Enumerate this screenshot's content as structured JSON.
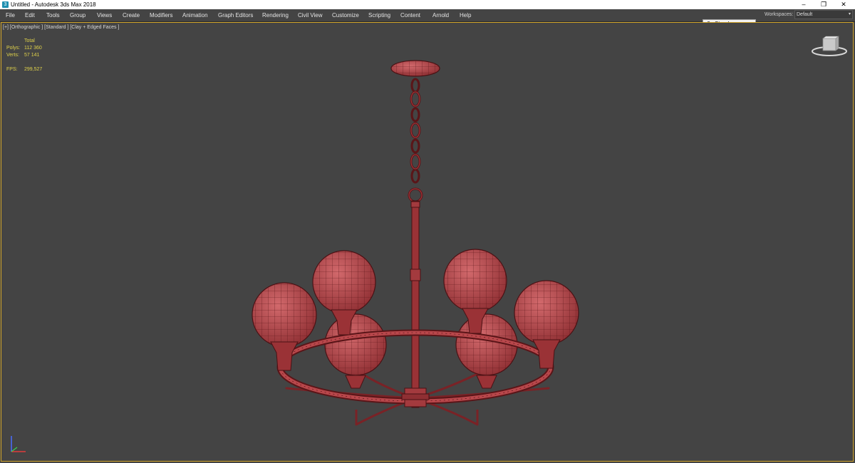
{
  "window": {
    "title": "Untitled - Autodesk 3ds Max 2018",
    "app_icon_glyph": "3",
    "controls": {
      "minimize": "–",
      "restore": "❐",
      "close": "✕"
    }
  },
  "menu": [
    "File",
    "Edit",
    "Tools",
    "Group",
    "Views",
    "Create",
    "Modifiers",
    "Animation",
    "Graph Editors",
    "Rendering",
    "Civil View",
    "Customize",
    "Scripting",
    "Content",
    "Arnold",
    "Help"
  ],
  "account": {
    "sign_in": "Sign In",
    "caret": "▾"
  },
  "workspaces": {
    "label": "Workspaces:",
    "selected": "Default",
    "caret": "▾"
  },
  "viewport": {
    "label": "[+] [Orthographic ] [Standard ] [Clay + Edged Faces ]",
    "stats": {
      "header": "Total",
      "polys_label": "Polys:",
      "polys_value": "112 360",
      "verts_label": "Verts:",
      "verts_value": "57 141",
      "fps_label": "FPS:",
      "fps_value": "299,527"
    },
    "icons": [
      "view-cube-icon",
      "axis-tripod-icon"
    ]
  },
  "colors": {
    "viewport_bg": "#444444",
    "active_border": "#d2a52a",
    "stats_text": "#e0d24a",
    "model_fill": "#b8474b",
    "model_wire": "#5a1518"
  }
}
